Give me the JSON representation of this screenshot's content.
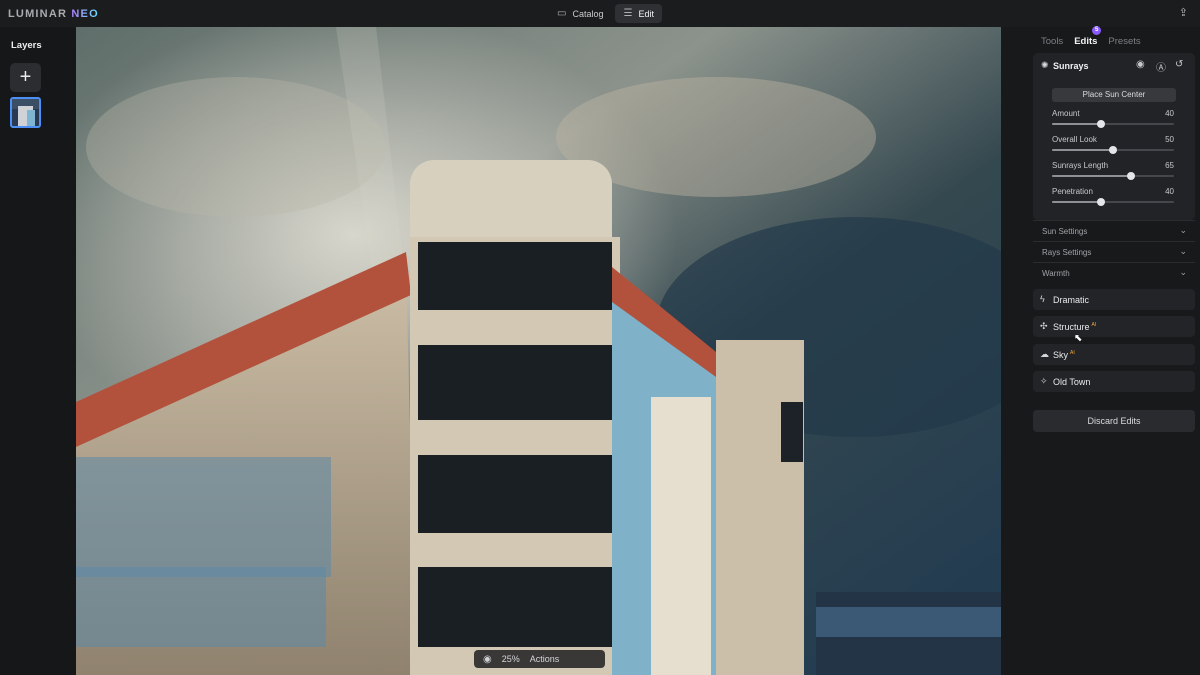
{
  "app": {
    "logo_main": "LUMINAR",
    "logo_accent": "NEO"
  },
  "topbar": {
    "modes": [
      {
        "label": "Catalog",
        "icon": "folder-icon",
        "active": false
      },
      {
        "label": "Edit",
        "icon": "sliders-icon",
        "active": true
      }
    ],
    "share_icon": "share-icon"
  },
  "layers": {
    "title": "Layers",
    "add_icon": "plus-icon"
  },
  "canvas": {
    "zoom": "25%",
    "actions": "Actions"
  },
  "panel": {
    "tabs": [
      {
        "label": "Tools",
        "active": false
      },
      {
        "label": "Edits",
        "active": true,
        "badge": "5"
      },
      {
        "label": "Presets",
        "active": false
      }
    ],
    "tool": {
      "name": "Sunrays",
      "place_button": "Place Sun Center",
      "sliders": [
        {
          "label": "Amount",
          "value": 40
        },
        {
          "label": "Overall Look",
          "value": 50
        },
        {
          "label": "Sunrays Length",
          "value": 65
        },
        {
          "label": "Penetration",
          "value": 40
        }
      ],
      "sections": [
        "Sun Settings",
        "Rays Settings",
        "Warmth"
      ]
    },
    "applied_tools": [
      {
        "label": "Dramatic",
        "icon": "lightning-icon",
        "ai": ""
      },
      {
        "label": "Structure",
        "icon": "structure-icon",
        "ai": "AI"
      },
      {
        "label": "Sky",
        "icon": "cloud-icon",
        "ai": "AI"
      },
      {
        "label": "Old Town",
        "icon": "old-town-icon",
        "ai": ""
      }
    ],
    "discard": "Discard Edits"
  }
}
